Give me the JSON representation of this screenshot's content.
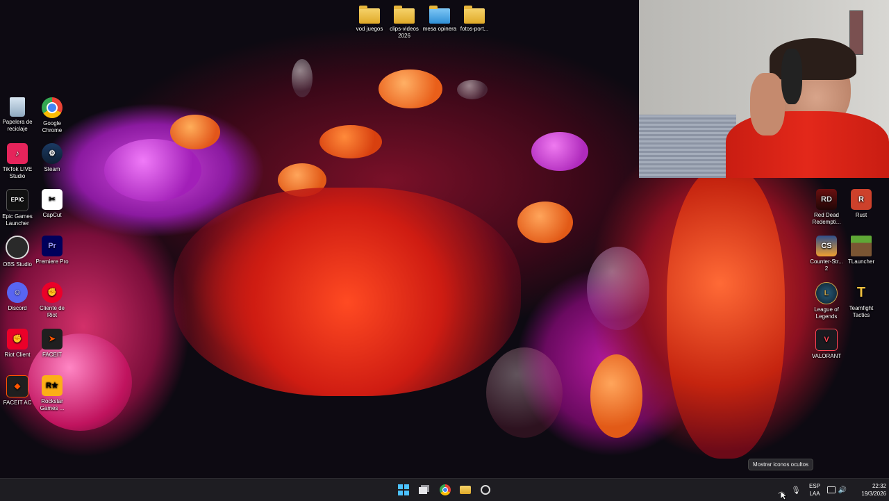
{
  "desktop": {
    "top_folders": [
      {
        "name": "folder-vod-juegos",
        "label": "vod juegos"
      },
      {
        "name": "folder-clips-videos",
        "label": "clips-videos 2026"
      },
      {
        "name": "folder-mesa-opinera",
        "label": "mesa opinera"
      },
      {
        "name": "folder-fotos-port",
        "label": "fotos-port..."
      }
    ],
    "left_icons": [
      {
        "label": "Papelera de reciclaje",
        "icon": "recycle-bin-icon"
      },
      {
        "label": "Google Chrome",
        "icon": "chrome-icon"
      },
      {
        "label": "TikTok LIVE Studio",
        "icon": "tiktok-icon"
      },
      {
        "label": "Steam",
        "icon": "steam-icon"
      },
      {
        "label": "Epic Games Launcher",
        "icon": "epic-games-icon"
      },
      {
        "label": "CapCut",
        "icon": "capcut-icon"
      },
      {
        "label": "OBS Studio",
        "icon": "obs-icon"
      },
      {
        "label": "Premiere Pro",
        "icon": "premiere-icon"
      },
      {
        "label": "Discord",
        "icon": "discord-icon"
      },
      {
        "label": "Cliente de Riot",
        "icon": "riot-client-icon"
      },
      {
        "label": "Riot Client",
        "icon": "riot-client-icon"
      },
      {
        "label": "FACEIT",
        "icon": "faceit-icon"
      },
      {
        "label": "FACEIT AC",
        "icon": "faceit-ac-icon"
      },
      {
        "label": "Rockstar Games ...",
        "icon": "rockstar-icon"
      }
    ],
    "right_icons": [
      {
        "label": "Red Dead Redempti...",
        "icon": "red-dead-icon"
      },
      {
        "label": "Rust",
        "icon": "rust-icon"
      },
      {
        "label": "Counter-Str... 2",
        "icon": "counter-strike-icon"
      },
      {
        "label": "TLauncher",
        "icon": "tlauncher-icon"
      },
      {
        "label": "League of Legends",
        "icon": "league-icon"
      },
      {
        "label": "Teamfight Tactics",
        "icon": "tft-icon"
      },
      {
        "label": "VALORANT",
        "icon": "valorant-icon"
      }
    ]
  },
  "webcam": {
    "label": "webcam-overlay"
  },
  "tooltip": {
    "text": "Mostrar iconos ocultos"
  },
  "taskbar": {
    "language_top": "ESP",
    "language_bottom": "LAA",
    "time": "22:32",
    "date": "19/3/2026"
  },
  "colors": {
    "taskbar_bg": "#1e1d22",
    "windows_blue": "#4cc2ff"
  }
}
